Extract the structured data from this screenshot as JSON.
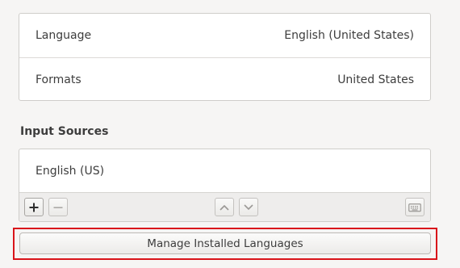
{
  "region": {
    "language_label": "Language",
    "language_value": "English (United States)",
    "formats_label": "Formats",
    "formats_value": "United States"
  },
  "input_sources": {
    "title": "Input Sources",
    "items": [
      {
        "label": "English (US)"
      }
    ],
    "toolbar": {
      "add_icon": "plus-icon",
      "remove_icon": "minus-icon",
      "up_icon": "chevron-up-icon",
      "down_icon": "chevron-down-icon",
      "keyboard_icon": "keyboard-icon"
    }
  },
  "manage_button": {
    "label": "Manage Installed Languages"
  },
  "colors": {
    "highlight": "#d9141a",
    "panel_background": "#ffffff",
    "window_background": "#f6f5f4"
  }
}
